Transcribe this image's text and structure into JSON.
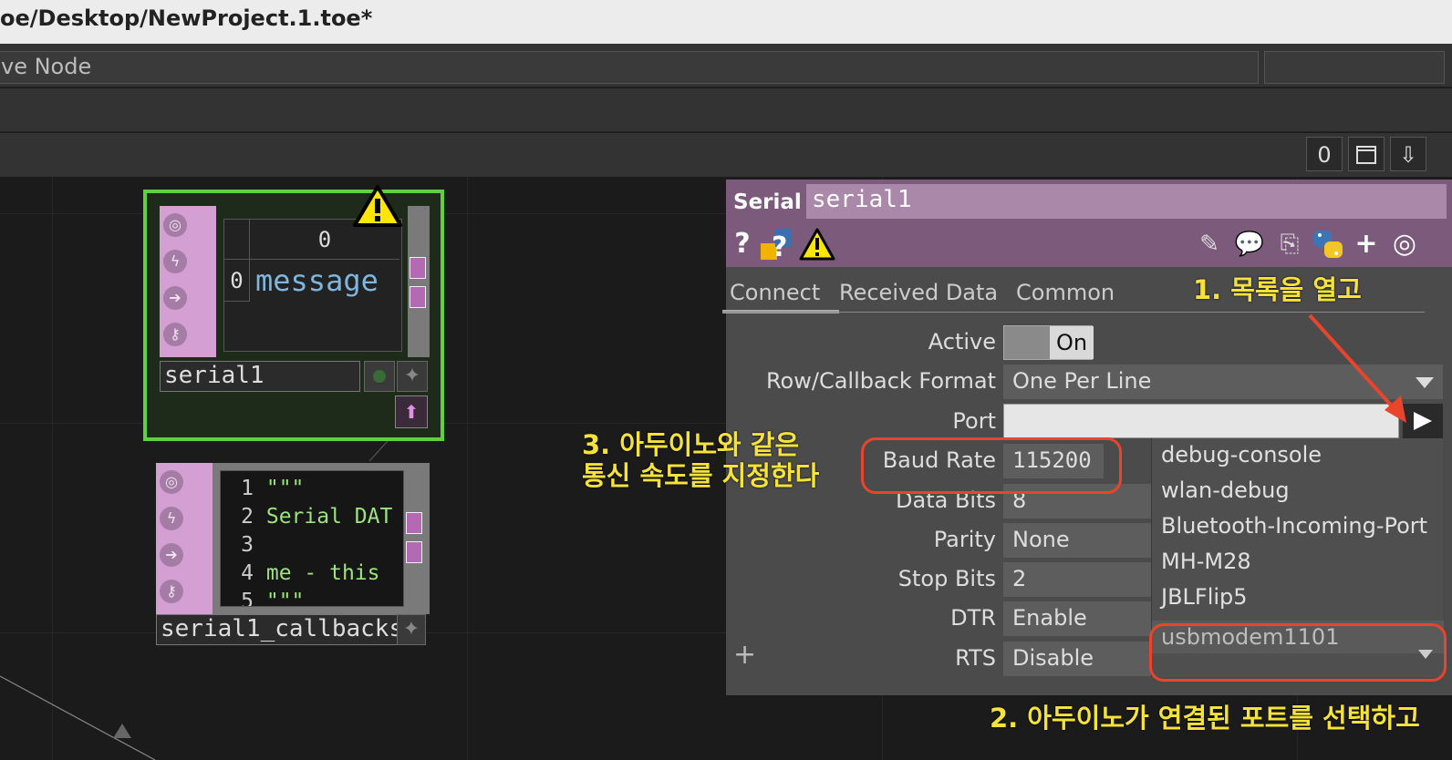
{
  "window": {
    "title": "oe/Desktop/NewProject.1.toe*"
  },
  "path_bar": {
    "text": "ve Node"
  },
  "toolbar": {
    "counter": "0",
    "window_icon": "window-icon",
    "down_icon": "arrow-down-icon"
  },
  "nodes": {
    "serial1": {
      "name": "serial1",
      "table_header": "0",
      "row_index": "0",
      "row_value": "message"
    },
    "callbacks": {
      "name": "serial1_callbacks",
      "lines": [
        {
          "num": "1",
          "text": "\"\"\""
        },
        {
          "num": "2",
          "text": "Serial DAT"
        },
        {
          "num": "3",
          "text": ""
        },
        {
          "num": "4",
          "text": "me - this"
        },
        {
          "num": "5",
          "text": "\"\"\""
        }
      ]
    }
  },
  "panel": {
    "type_label": "Serial",
    "op_name": "serial1",
    "tabs": [
      "Connect",
      "Received Data",
      "Common"
    ],
    "params": {
      "active": {
        "label": "Active",
        "value": "On"
      },
      "row_format": {
        "label": "Row/Callback Format",
        "value": "One Per Line"
      },
      "port": {
        "label": "Port",
        "value": ""
      },
      "baud": {
        "label": "Baud Rate",
        "value": "115200"
      },
      "data_bits": {
        "label": "Data Bits",
        "value": "8"
      },
      "parity": {
        "label": "Parity",
        "value": "None"
      },
      "stop_bits": {
        "label": "Stop Bits",
        "value": "2"
      },
      "dtr": {
        "label": "DTR",
        "value": "Enable"
      },
      "rts": {
        "label": "RTS",
        "value": "Disable"
      }
    },
    "port_options": [
      "debug-console",
      "wlan-debug",
      "Bluetooth-Incoming-Port",
      "MH-M28",
      "JBLFlip5",
      "usbmodem1101"
    ]
  },
  "annotations": {
    "step1": "1. 목록을 열고",
    "step2": "2. 아두이노가 연결된 포트를 선택하고",
    "step3_line1": "3. 아두이노와 같은",
    "step3_line2": "통신 속도를 지정한다"
  },
  "colors": {
    "accent_red": "#e8452c",
    "annotation_yellow": "#f5e23a",
    "selected_node": "#5fd13e",
    "panel_header": "#7b5a7c"
  }
}
